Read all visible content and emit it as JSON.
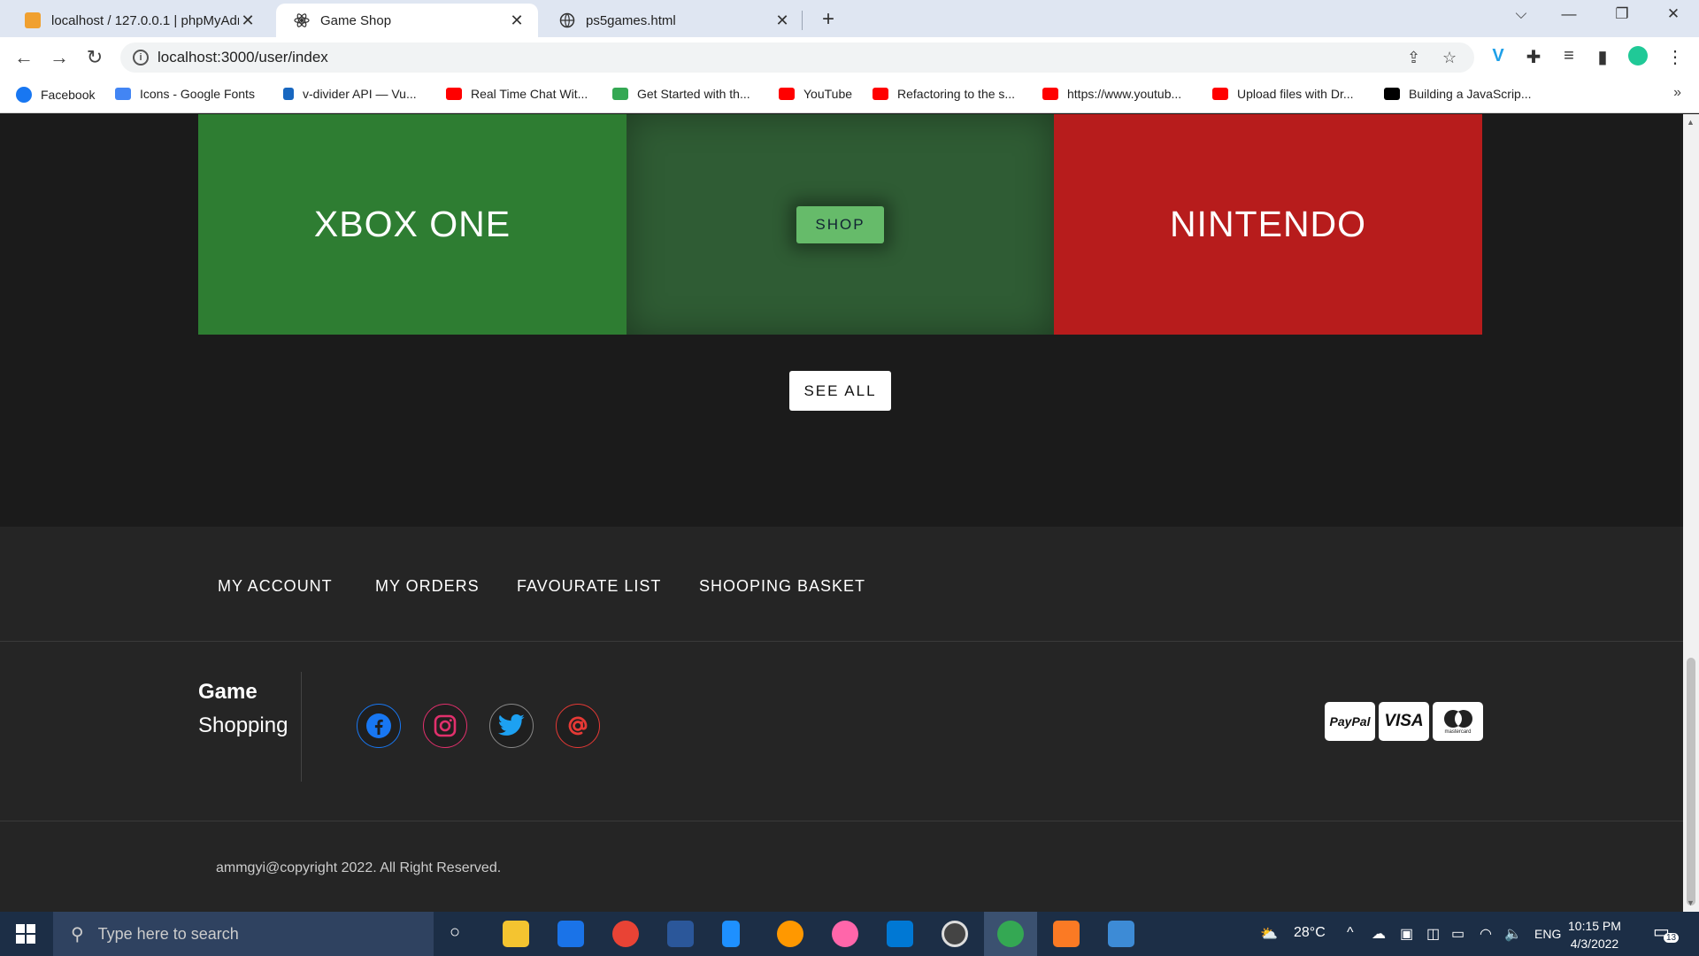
{
  "browser": {
    "tabs": [
      {
        "title": "localhost / 127.0.0.1 | phpMyAdmin",
        "close": "✕"
      },
      {
        "title": "Game Shop",
        "close": "✕"
      },
      {
        "title": "ps5games.html",
        "close": "✕"
      }
    ],
    "new_tab": "+",
    "address": "localhost:3000/user/index",
    "bookmarks": [
      {
        "label": "Facebook",
        "color": "#1877f2"
      },
      {
        "label": "Icons - Google Fonts",
        "color": "#4285f4"
      },
      {
        "label": "v-divider API — Vu...",
        "color": "#1867c0"
      },
      {
        "label": "Real Time Chat Wit...",
        "color": "#ff0000"
      },
      {
        "label": "Get Started with th...",
        "color": "#34a853"
      },
      {
        "label": "YouTube",
        "color": "#ff0000"
      },
      {
        "label": "Refactoring to the s...",
        "color": "#ff0000"
      },
      {
        "label": "https://www.youtub...",
        "color": "#ff0000"
      },
      {
        "label": "Upload files with Dr...",
        "color": "#ff0000"
      },
      {
        "label": "Building a JavaScrip...",
        "color": "#000000"
      }
    ],
    "bookmarks_more": "»"
  },
  "categories": {
    "left": "XBOX ONE",
    "middle_button": "SHOP",
    "right": "NINTENDO"
  },
  "see_all": "SEE ALL",
  "footer": {
    "nav": [
      "MY ACCOUNT",
      "MY ORDERS",
      "FAVOURATE LIST",
      "SHOOPING BASKET"
    ],
    "brand_line1": "Game",
    "brand_line2": "Shopping",
    "social": [
      {
        "icon": "facebook-icon",
        "color": "#1877f2"
      },
      {
        "icon": "instagram-icon",
        "color": "#e1306c"
      },
      {
        "icon": "twitter-icon",
        "color": "#1da1f2"
      },
      {
        "icon": "email-at-icon",
        "color": "#e53935"
      }
    ],
    "payments": {
      "paypal": "PayPal",
      "visa": "VISA",
      "mastercard": "mastercard"
    },
    "copyright": "ammgyi@copyright 2022. All Right Reserved."
  },
  "taskbar": {
    "search_placeholder": "Type here to search",
    "weather": "28°C",
    "language": "ENG",
    "time": "10:15 PM",
    "date": "4/3/2022",
    "notifications": "13"
  }
}
